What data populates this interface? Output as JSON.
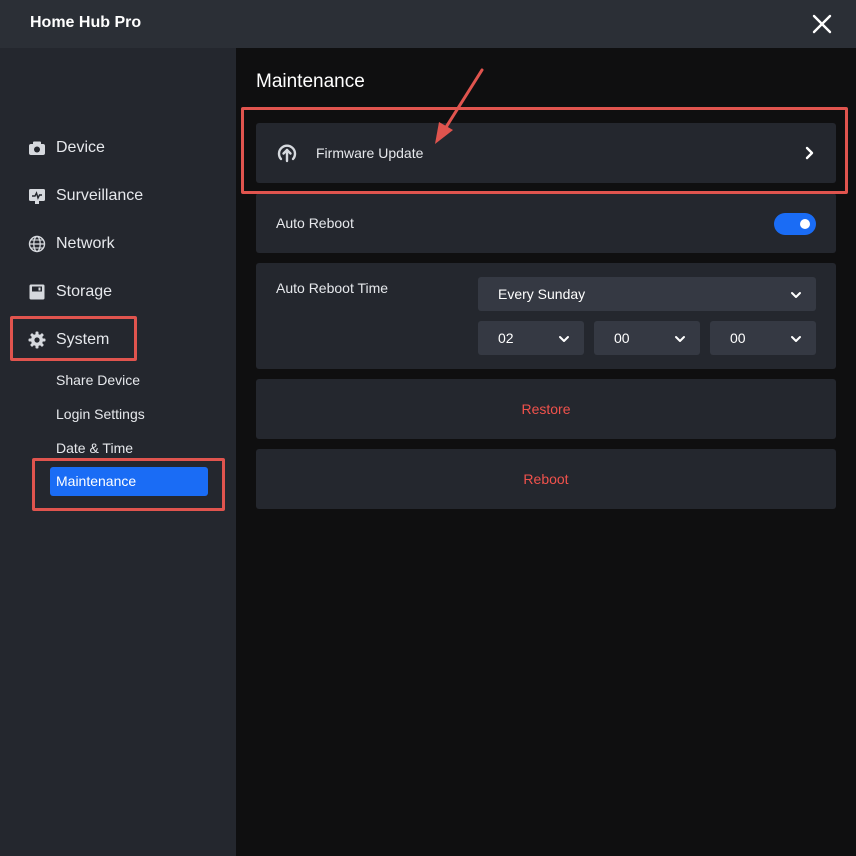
{
  "app": {
    "title": "Home Hub Pro"
  },
  "sidebar": {
    "items": [
      {
        "label": "Device",
        "icon": "camera-icon"
      },
      {
        "label": "Surveillance",
        "icon": "monitor-icon"
      },
      {
        "label": "Network",
        "icon": "globe-icon"
      },
      {
        "label": "Storage",
        "icon": "storage-icon"
      },
      {
        "label": "System",
        "icon": "gear-icon"
      }
    ],
    "sub_items": [
      {
        "label": "Share Device"
      },
      {
        "label": "Login Settings"
      },
      {
        "label": "Date & Time"
      },
      {
        "label": "Maintenance",
        "active": true
      }
    ]
  },
  "main": {
    "title": "Maintenance",
    "firmware": {
      "label": "Firmware Update"
    },
    "auto_reboot": {
      "label": "Auto Reboot",
      "enabled": true
    },
    "auto_reboot_time": {
      "label": "Auto Reboot Time",
      "day": "Every Sunday",
      "hour": "02",
      "minute": "00",
      "second": "00"
    },
    "restore": {
      "label": "Restore"
    },
    "reboot": {
      "label": "Reboot"
    }
  },
  "colors": {
    "accent": "#1a6cf5",
    "danger": "#f0524c",
    "highlight": "#e0544e"
  }
}
